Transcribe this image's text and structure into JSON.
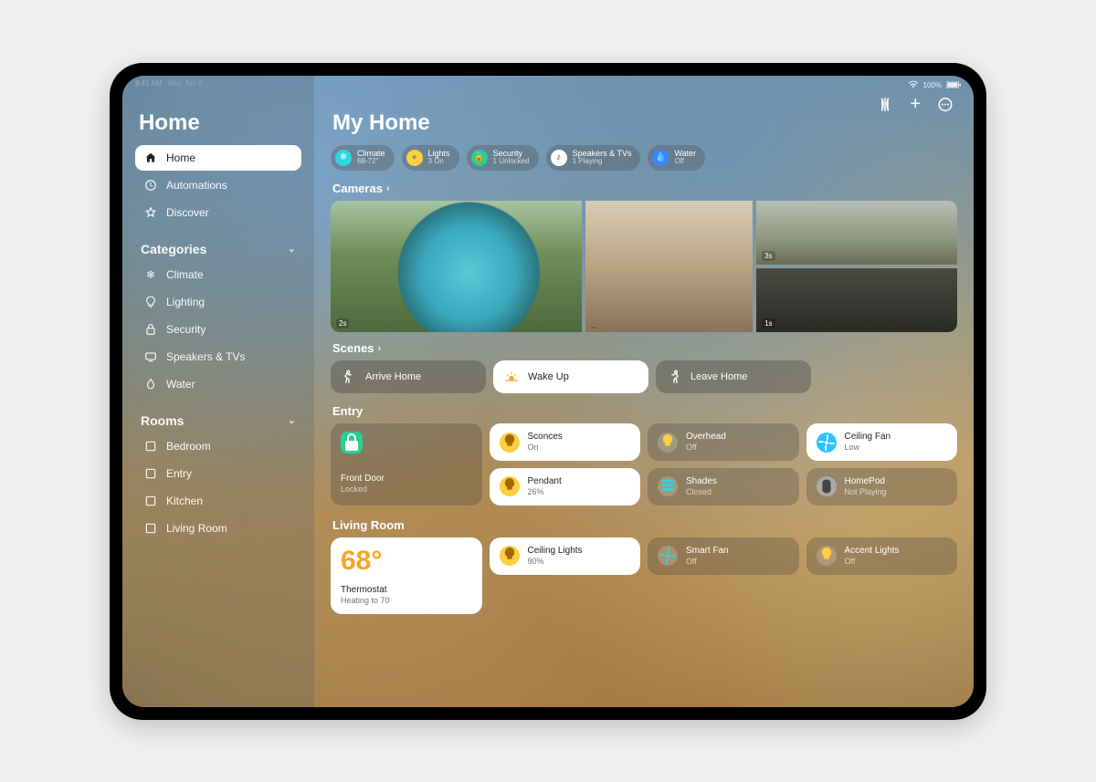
{
  "status": {
    "time": "9:41 AM",
    "date": "Mon Jun 6",
    "battery": "100%"
  },
  "sidebar": {
    "title": "Home",
    "nav": [
      {
        "label": "Home"
      },
      {
        "label": "Automations"
      },
      {
        "label": "Discover"
      }
    ],
    "categories_header": "Categories",
    "categories": [
      {
        "label": "Climate"
      },
      {
        "label": "Lighting"
      },
      {
        "label": "Security"
      },
      {
        "label": "Speakers & TVs"
      },
      {
        "label": "Water"
      }
    ],
    "rooms_header": "Rooms",
    "rooms": [
      {
        "label": "Bedroom"
      },
      {
        "label": "Entry"
      },
      {
        "label": "Kitchen"
      },
      {
        "label": "Living Room"
      }
    ]
  },
  "main": {
    "title": "My Home",
    "pills": [
      {
        "label": "Climate",
        "sub": "68-72°",
        "color": "#2ed6e0"
      },
      {
        "label": "Lights",
        "sub": "3 On",
        "color": "#ffcf3f"
      },
      {
        "label": "Security",
        "sub": "1 Unlocked",
        "color": "#2bcf8f"
      },
      {
        "label": "Speakers & TVs",
        "sub": "1 Playing",
        "color": "#ffffff"
      },
      {
        "label": "Water",
        "sub": "Off",
        "color": "#3a86ff"
      }
    ],
    "cameras_header": "Cameras",
    "cameras": [
      {
        "ts": "2s"
      },
      {
        "ts": "3s"
      },
      {
        "ts": ""
      },
      {
        "ts": "1s"
      }
    ],
    "scenes_header": "Scenes",
    "scenes": [
      {
        "label": "Arrive Home"
      },
      {
        "label": "Wake Up"
      },
      {
        "label": "Leave Home"
      }
    ],
    "entry_header": "Entry",
    "entry": {
      "lock": {
        "label": "Front Door",
        "sub": "Locked"
      },
      "tiles": [
        {
          "label": "Sconces",
          "sub": "On",
          "on": true,
          "icon": "bulb",
          "color": "c-yellow"
        },
        {
          "label": "Overhead",
          "sub": "Off",
          "on": false,
          "icon": "bulb",
          "color": "c-dim"
        },
        {
          "label": "Ceiling Fan",
          "sub": "Low",
          "on": true,
          "icon": "fan",
          "color": "c-cyan"
        },
        {
          "label": "Pendant",
          "sub": "26%",
          "on": true,
          "icon": "bulb",
          "color": "c-yellow"
        },
        {
          "label": "Shades",
          "sub": "Closed",
          "on": false,
          "icon": "shade",
          "color": "c-dimteal"
        },
        {
          "label": "HomePod",
          "sub": "Not Playing",
          "on": false,
          "icon": "speaker",
          "color": "c-gray"
        }
      ]
    },
    "living_header": "Living Room",
    "living": {
      "thermo": {
        "temp": "68°",
        "label": "Thermostat",
        "sub": "Heating to 70"
      },
      "tiles": [
        {
          "label": "Ceiling Lights",
          "sub": "90%",
          "on": true,
          "icon": "bulb",
          "color": "c-yellow"
        },
        {
          "label": "Smart Fan",
          "sub": "Off",
          "on": false,
          "icon": "fan",
          "color": "c-dimteal"
        },
        {
          "label": "Accent Lights",
          "sub": "Off",
          "on": false,
          "icon": "bulb",
          "color": "c-dim"
        }
      ]
    }
  }
}
